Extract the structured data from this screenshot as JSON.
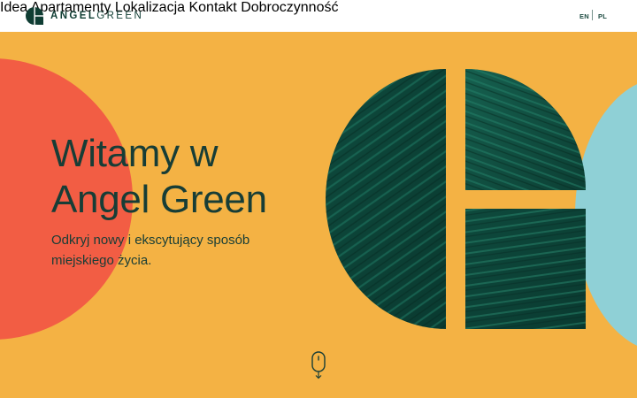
{
  "brand": {
    "name_bold": "ANGEL",
    "name_light": "GREEN"
  },
  "nav": {
    "items": [
      "Idea",
      "Apartamenty",
      "Lokalizacja",
      "Kontakt",
      "Dobroczynność"
    ]
  },
  "language": {
    "en": "EN",
    "pl": "PL"
  },
  "hero": {
    "title_line1": "Witamy w",
    "title_line2": "Angel Green",
    "subtitle": "Odkryj nowy i ekscytujący sposób miejskiego życia."
  },
  "colors": {
    "background": "#f4b244",
    "accent_red": "#f25d44",
    "accent_blue": "#8fd0d6",
    "dark_green": "#0f3d33"
  },
  "icons": [
    "angel-green-logo-icon",
    "leaf-pattern-logo-art",
    "scroll-down-mouse-icon"
  ]
}
